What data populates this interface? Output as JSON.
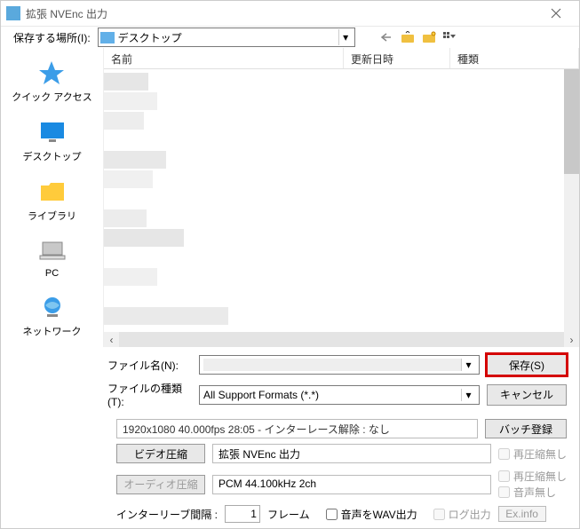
{
  "window": {
    "title": "拡張 NVEnc 出力"
  },
  "toolbar": {
    "save_in_label": "保存する場所(I):",
    "location": "デスクトップ"
  },
  "sidebar": {
    "items": [
      {
        "label": "クイック アクセス"
      },
      {
        "label": "デスクトップ"
      },
      {
        "label": "ライブラリ"
      },
      {
        "label": "PC"
      },
      {
        "label": "ネットワーク"
      }
    ]
  },
  "columns": {
    "name": "名前",
    "date": "更新日時",
    "type": "種類"
  },
  "file": {
    "name_label": "ファイル名(N):",
    "name_value": "",
    "type_label": "ファイルの種類(T):",
    "type_value": "All Support Formats (*.*)"
  },
  "buttons": {
    "save": "保存(S)",
    "cancel": "キャンセル",
    "batch": "バッチ登録",
    "video_comp": "ビデオ圧縮",
    "audio_comp": "オーディオ圧縮",
    "exinfo": "Ex.info"
  },
  "info": {
    "status": "1920x1080  40.000fps  28:05  -  インターレース解除 : なし",
    "video_codec": "拡張 NVEnc 出力",
    "audio_codec": "PCM 44.100kHz 2ch"
  },
  "checks": {
    "no_recompress": "再圧縮無し",
    "no_recompress2": "再圧縮無し",
    "no_audio": "音声無し"
  },
  "interleave": {
    "label": "インターリーブ間隔 :",
    "value": "1",
    "unit": "フレーム",
    "wav_out": "音声をWAV出力",
    "log_out": "ログ出力"
  }
}
